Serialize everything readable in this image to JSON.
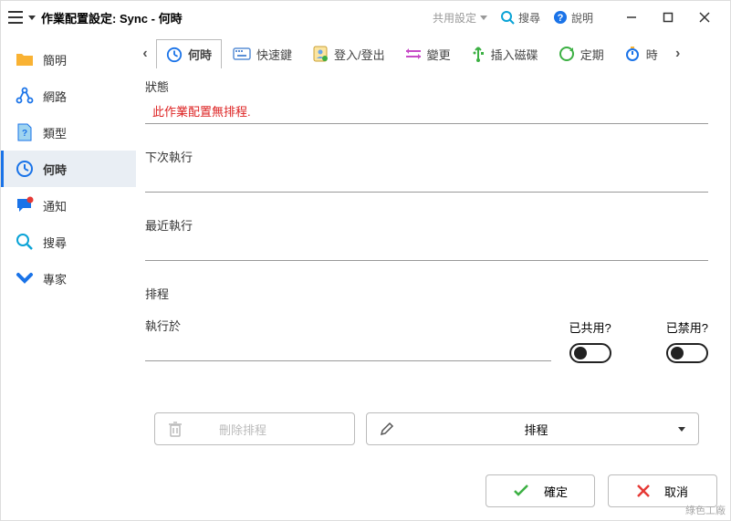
{
  "title": "作業配置設定: Sync - 何時",
  "titlebar": {
    "shared_settings": "共用設定",
    "search": "搜尋",
    "help": "說明"
  },
  "sidebar": {
    "items": [
      {
        "label": "簡明"
      },
      {
        "label": "網路"
      },
      {
        "label": "類型"
      },
      {
        "label": "何時"
      },
      {
        "label": "通知"
      },
      {
        "label": "搜尋"
      },
      {
        "label": "專家"
      }
    ]
  },
  "tabs": {
    "items": [
      {
        "label": "何時"
      },
      {
        "label": "快速鍵"
      },
      {
        "label": "登入/登出"
      },
      {
        "label": "變更"
      },
      {
        "label": "插入磁碟"
      },
      {
        "label": "定期"
      },
      {
        "label": "時"
      }
    ]
  },
  "fields": {
    "status_label": "狀態",
    "status_value": "此作業配置無排程.",
    "next_run_label": "下次執行",
    "next_run_value": "",
    "last_run_label": "最近執行",
    "last_run_value": "",
    "schedule_label": "排程",
    "run_at_label": "執行於",
    "run_at_value": "",
    "shared_label": "已共用?",
    "disabled_label": "已禁用?"
  },
  "buttons": {
    "delete_schedule": "刪除排程",
    "schedule_dropdown": "排程",
    "ok": "確定",
    "cancel": "取消"
  },
  "watermark": "綠色工廠"
}
